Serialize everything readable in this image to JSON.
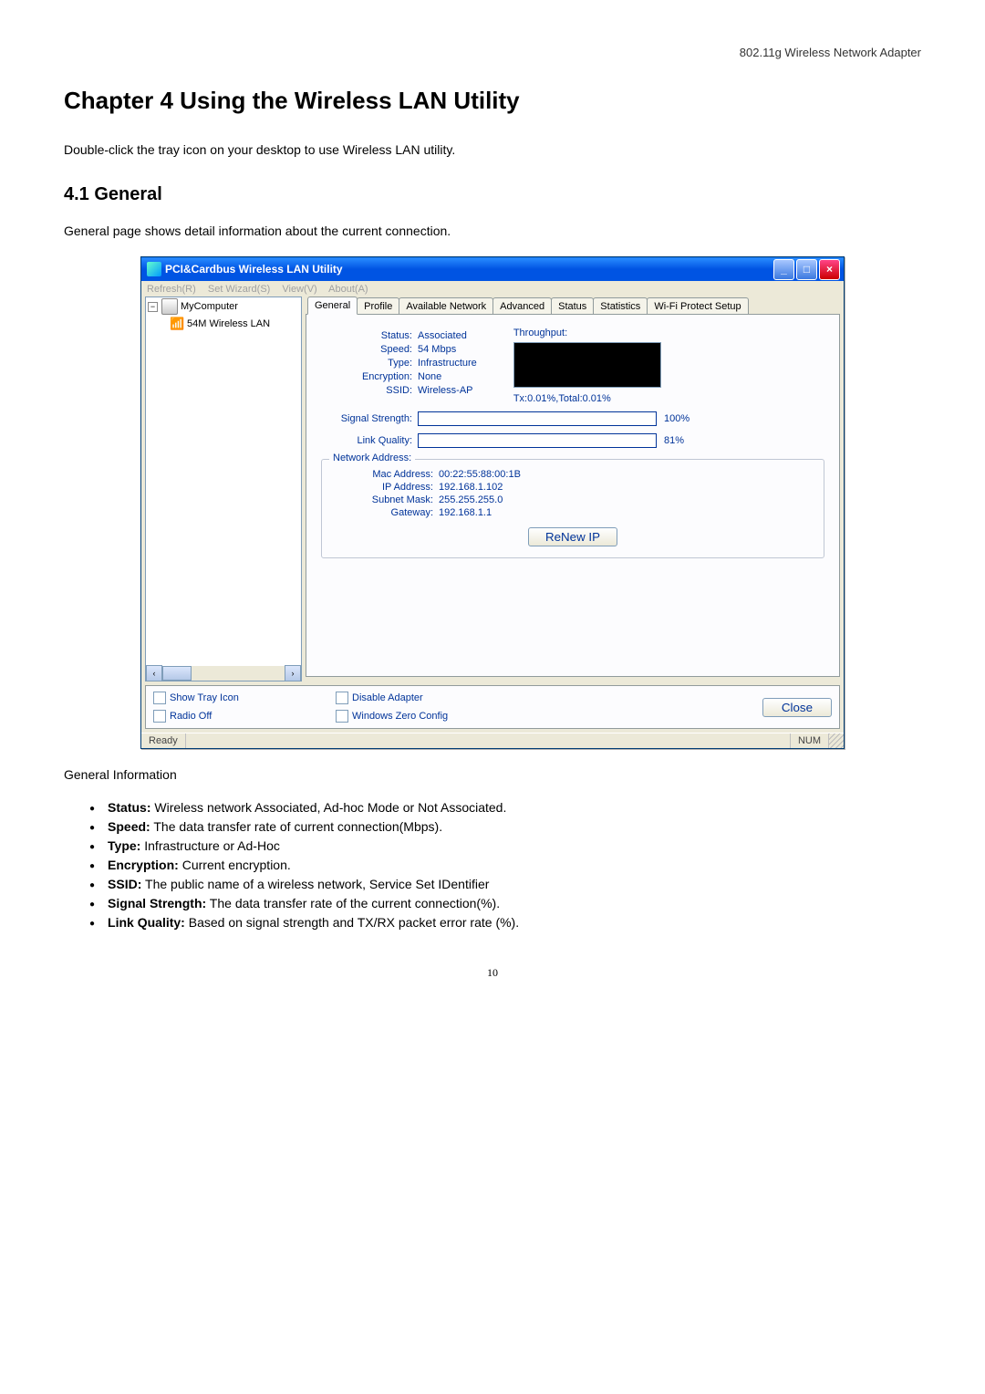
{
  "header": "802.11g Wireless Network Adapter",
  "chapter_title": "Chapter 4 Using the Wireless LAN Utility",
  "intro": "Double-click the tray icon on your desktop to use Wireless LAN utility.",
  "section_title": "4.1 General",
  "section_desc": "General page shows detail information about the current connection.",
  "window": {
    "title": "PCI&Cardbus Wireless LAN Utility",
    "menus": [
      "Refresh(R)",
      "Set Wizard(S)",
      "View(V)",
      "About(A)"
    ],
    "tree": {
      "root": "MyComputer",
      "child": "54M Wireless LAN"
    },
    "tabs": [
      "General",
      "Profile",
      "Available Network",
      "Advanced",
      "Status",
      "Statistics",
      "Wi-Fi Protect Setup"
    ],
    "active_tab": 0,
    "status_rows": {
      "status_label": "Status:",
      "status_value": "Associated",
      "speed_label": "Speed:",
      "speed_value": "54 Mbps",
      "type_label": "Type:",
      "type_value": "Infrastructure",
      "enc_label": "Encryption:",
      "enc_value": "None",
      "ssid_label": "SSID:",
      "ssid_value": "Wireless-AP"
    },
    "throughput_label": "Throughput:",
    "throughput_value": "Tx:0.01%,Total:0.01%",
    "signal": {
      "label": "Signal Strength:",
      "pct": "100%",
      "fill": 100
    },
    "link": {
      "label": "Link Quality:",
      "pct": "81%",
      "fill": 81
    },
    "netaddr": {
      "legend": "Network Address:",
      "mac_label": "Mac Address:",
      "mac_value": "00:22:55:88:00:1B",
      "ip_label": "IP Address:",
      "ip_value": "192.168.1.102",
      "mask_label": "Subnet Mask:",
      "mask_value": "255.255.255.0",
      "gw_label": "Gateway:",
      "gw_value": "192.168.1.1",
      "renew": "ReNew IP"
    },
    "bottom": {
      "show_tray": "Show Tray Icon",
      "radio_off": "Radio Off",
      "disable_adapter": "Disable Adapter",
      "win_zero": "Windows Zero Config",
      "close": "Close"
    },
    "statusbar": {
      "ready": "Ready",
      "num": "NUM"
    }
  },
  "general_info_title": "General Information",
  "bullets": [
    {
      "b": "Status:",
      "t": " Wireless network Associated, Ad-hoc Mode or Not Associated."
    },
    {
      "b": "Speed:",
      "t": " The data transfer rate of current connection(Mbps)."
    },
    {
      "b": "Type:",
      "t": " Infrastructure or Ad-Hoc"
    },
    {
      "b": "Encryption:",
      "t": " Current encryption."
    },
    {
      "b": "SSID:",
      "t": " The public name of a wireless network, Service Set IDentifier"
    },
    {
      "b": "Signal Strength:",
      "t": " The data transfer rate of the current connection(%)."
    },
    {
      "b": "Link Quality:",
      "t": " Based on signal strength and TX/RX packet error rate (%)."
    }
  ],
  "page_num": "10"
}
